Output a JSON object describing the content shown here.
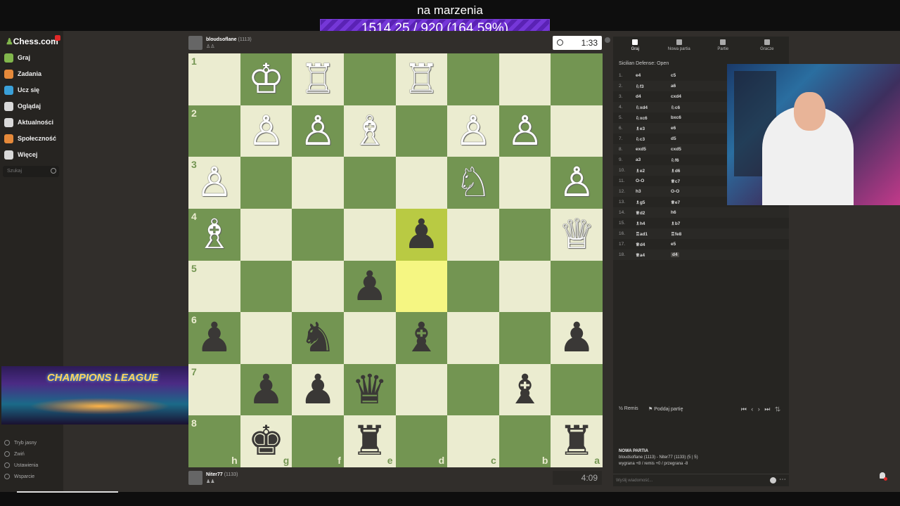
{
  "stream": {
    "title": "na marzenia",
    "counter": "1514.25 / 920 (164.59%)"
  },
  "sidebar": {
    "logo": "Chess.com",
    "items": [
      {
        "label": "Graj",
        "color": "#81b64c"
      },
      {
        "label": "Zadania",
        "color": "#e5893a"
      },
      {
        "label": "Ucz się",
        "color": "#3aa0d8"
      },
      {
        "label": "Oglądaj",
        "color": "#d9d9d9"
      },
      {
        "label": "Aktualności",
        "color": "#d9d9d9"
      },
      {
        "label": "Społeczność",
        "color": "#e5893a"
      },
      {
        "label": "Więcej",
        "color": "#d9d9d9"
      }
    ],
    "search_placeholder": "Szukaj",
    "bottom": [
      "Tryb jasny",
      "Zwiń",
      "Ustawienia",
      "Wsparcie"
    ]
  },
  "overlay": {
    "banner_text": "CHAMPIONS LEAGUE"
  },
  "top_player": {
    "name": "bloudsoflane",
    "rating": "(1113)",
    "clock": "1:33"
  },
  "bottom_player": {
    "name": "Niter77",
    "rating": "(1133)",
    "clock": "4:09"
  },
  "board": {
    "rank_labels": [
      "1",
      "2",
      "3",
      "4",
      "5",
      "6",
      "7",
      "8"
    ],
    "file_labels": [
      "h",
      "g",
      "f",
      "e",
      "d",
      "c",
      "b",
      "a"
    ],
    "highlight": [
      [
        3,
        4
      ],
      [
        4,
        4
      ]
    ],
    "pieces": [
      {
        "r": 0,
        "c": 1,
        "p": "♔",
        "side": "w"
      },
      {
        "r": 0,
        "c": 2,
        "p": "♖",
        "side": "w"
      },
      {
        "r": 0,
        "c": 4,
        "p": "♖",
        "side": "w"
      },
      {
        "r": 1,
        "c": 1,
        "p": "♙",
        "side": "w"
      },
      {
        "r": 1,
        "c": 2,
        "p": "♙",
        "side": "w"
      },
      {
        "r": 1,
        "c": 3,
        "p": "♗",
        "side": "w"
      },
      {
        "r": 1,
        "c": 5,
        "p": "♙",
        "side": "w"
      },
      {
        "r": 1,
        "c": 6,
        "p": "♙",
        "side": "w"
      },
      {
        "r": 2,
        "c": 0,
        "p": "♙",
        "side": "w"
      },
      {
        "r": 2,
        "c": 5,
        "p": "♘",
        "side": "w"
      },
      {
        "r": 2,
        "c": 7,
        "p": "♙",
        "side": "w"
      },
      {
        "r": 3,
        "c": 0,
        "p": "♗",
        "side": "w"
      },
      {
        "r": 3,
        "c": 4,
        "p": "♟",
        "side": "b"
      },
      {
        "r": 3,
        "c": 7,
        "p": "♕",
        "side": "w"
      },
      {
        "r": 4,
        "c": 3,
        "p": "♟",
        "side": "b"
      },
      {
        "r": 5,
        "c": 0,
        "p": "♟",
        "side": "b"
      },
      {
        "r": 5,
        "c": 2,
        "p": "♞",
        "side": "b"
      },
      {
        "r": 5,
        "c": 4,
        "p": "♝",
        "side": "b"
      },
      {
        "r": 5,
        "c": 7,
        "p": "♟",
        "side": "b"
      },
      {
        "r": 6,
        "c": 1,
        "p": "♟",
        "side": "b"
      },
      {
        "r": 6,
        "c": 2,
        "p": "♟",
        "side": "b"
      },
      {
        "r": 6,
        "c": 3,
        "p": "♛",
        "side": "b"
      },
      {
        "r": 6,
        "c": 6,
        "p": "♝",
        "side": "b"
      },
      {
        "r": 7,
        "c": 1,
        "p": "♚",
        "side": "b"
      },
      {
        "r": 7,
        "c": 3,
        "p": "♜",
        "side": "b"
      },
      {
        "r": 7,
        "c": 7,
        "p": "♜",
        "side": "b"
      }
    ]
  },
  "panel": {
    "tabs": [
      "Graj",
      "Nowa partia",
      "Partie",
      "Gracze"
    ],
    "opening": "Sicilian Defense: Open",
    "moves": [
      {
        "n": "1.",
        "w": "e4",
        "b": "c5"
      },
      {
        "n": "2.",
        "w": "♘f3",
        "b": "a6"
      },
      {
        "n": "3.",
        "w": "d4",
        "b": "cxd4"
      },
      {
        "n": "4.",
        "w": "♘xd4",
        "b": "♘c6"
      },
      {
        "n": "5.",
        "w": "♘xc6",
        "b": "bxc6"
      },
      {
        "n": "6.",
        "w": "♗e3",
        "b": "e6"
      },
      {
        "n": "7.",
        "w": "♘c3",
        "b": "d5"
      },
      {
        "n": "8.",
        "w": "exd5",
        "b": "cxd5"
      },
      {
        "n": "9.",
        "w": "a3",
        "b": "♘f6"
      },
      {
        "n": "10.",
        "w": "♗e2",
        "b": "♗d6"
      },
      {
        "n": "11.",
        "w": "O-O",
        "b": "♕c7"
      },
      {
        "n": "12.",
        "w": "h3",
        "b": "O-O"
      },
      {
        "n": "13.",
        "w": "♗g5",
        "b": "♕e7"
      },
      {
        "n": "14.",
        "w": "♕d2",
        "b": "h6"
      },
      {
        "n": "15.",
        "w": "♗h4",
        "b": "♗b7"
      },
      {
        "n": "16.",
        "w": "♖ad1",
        "b": "♖fe8"
      },
      {
        "n": "17.",
        "w": "♕d4",
        "b": "e5"
      },
      {
        "n": "18.",
        "w": "♕a4",
        "b": "d4"
      }
    ],
    "remis": "Remis",
    "resign": "Poddaj partię",
    "new_game_title": "NOWA PARTIA",
    "new_game_line1": "bloudsoflane (1113) - Niter77 (1133) (5 | 5)",
    "new_game_line2": "wygrana +8 / remis +0 / przegrana -8",
    "chat_placeholder": "Wyślij wiadomość..."
  }
}
